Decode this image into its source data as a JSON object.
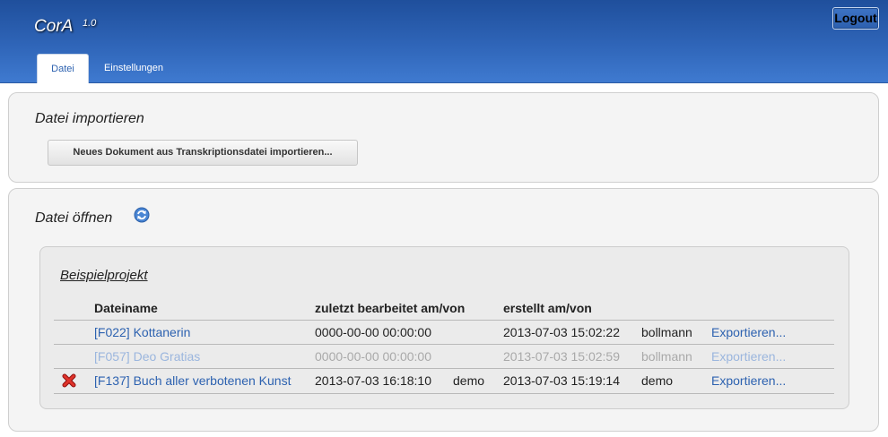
{
  "app": {
    "title": "CorA",
    "version": "1.0",
    "logout_label": "Logout"
  },
  "tabs": [
    {
      "label": "Datei",
      "active": true
    },
    {
      "label": "Einstellungen",
      "active": false
    }
  ],
  "import_section": {
    "title": "Datei importieren",
    "button_label": "Neues Dokument aus Transkriptionsdatei importieren..."
  },
  "open_section": {
    "title": "Datei öffnen",
    "refresh_icon": "refresh-icon",
    "project": {
      "name": "Beispielprojekt",
      "columns": {
        "filename": "Dateiname",
        "last_edited": "zuletzt bearbeitet am/von",
        "created": "erstellt am/von"
      },
      "rows": [
        {
          "filename": "[F022] Kottanerin",
          "edited_at": "0000-00-00 00:00:00",
          "edited_by": "",
          "created_at": "2013-07-03 15:02:22",
          "created_by": "bollmann",
          "export_label": "Exportieren...",
          "deletable": false,
          "faded": false
        },
        {
          "filename": "[F057] Deo Gratias",
          "edited_at": "0000-00-00 00:00:00",
          "edited_by": "",
          "created_at": "2013-07-03 15:02:59",
          "created_by": "bollmann",
          "export_label": "Exportieren...",
          "deletable": false,
          "faded": true
        },
        {
          "filename": "[F137] Buch aller verbotenen Kunst",
          "edited_at": "2013-07-03 16:18:10",
          "edited_by": "demo",
          "created_at": "2013-07-03 15:19:14",
          "created_by": "demo",
          "export_label": "Exportieren...",
          "deletable": true,
          "faded": false
        }
      ]
    }
  },
  "colors": {
    "header": "#2f65b8",
    "link": "#2d62b0",
    "panel": "#f4f4f4",
    "delete": "#d9261c"
  }
}
